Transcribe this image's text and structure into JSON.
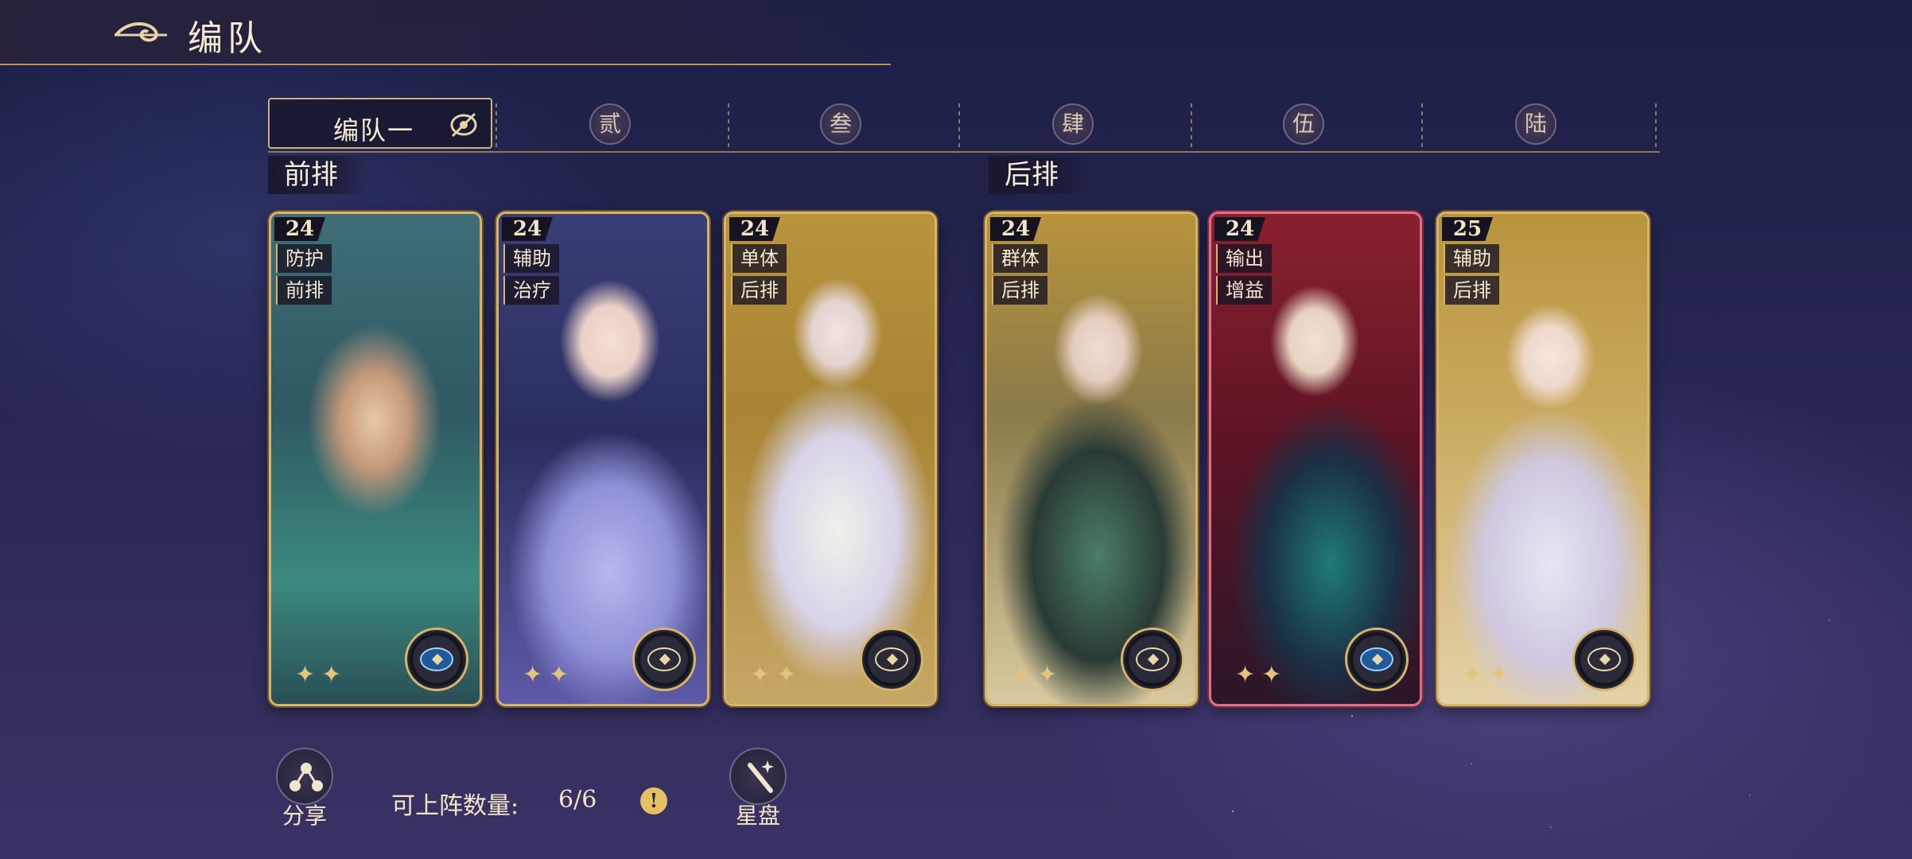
{
  "header": {
    "title": "编队",
    "icon": "cloud-swirl-icon"
  },
  "tabs": {
    "active_label": "编队一",
    "items": [
      "贰",
      "叁",
      "肆",
      "伍",
      "陆"
    ]
  },
  "rows": {
    "front": "前排",
    "back": "后排"
  },
  "cards": [
    {
      "level": "24",
      "tag1": "防护",
      "tag2": "前排",
      "badge": "blue-compass-icon",
      "frame": "gold"
    },
    {
      "level": "24",
      "tag1": "辅助",
      "tag2": "治疗",
      "badge": "dark-compass-icon",
      "frame": "gold"
    },
    {
      "level": "24",
      "tag1": "单体",
      "tag2": "后排",
      "badge": "dark-compass-icon",
      "frame": "gold"
    },
    {
      "level": "24",
      "tag1": "群体",
      "tag2": "后排",
      "badge": "dark-compass-icon",
      "frame": "gold"
    },
    {
      "level": "24",
      "tag1": "输出",
      "tag2": "增益",
      "badge": "blue-compass-icon",
      "frame": "red"
    },
    {
      "level": "25",
      "tag1": "辅助",
      "tag2": "后排",
      "badge": "dark-compass-icon",
      "frame": "gold"
    }
  ],
  "bottom": {
    "share_label": "分享",
    "deploy_label": "可上阵数量:",
    "deploy_value": "6/6",
    "info_glyph": "!",
    "starchart_label": "星盘"
  },
  "colors": {
    "gold": "#d7b469",
    "red_frame": "#e06f8a",
    "bg": "#272653"
  }
}
